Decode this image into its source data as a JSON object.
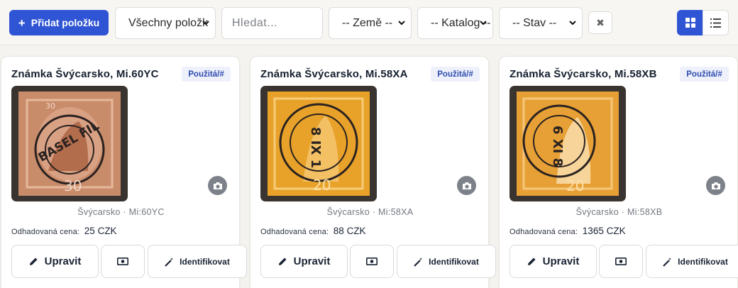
{
  "toolbar": {
    "add_label": "Přidat položku",
    "filter_all": "Všechny položk",
    "search_placeholder": "Hledat...",
    "country": "-- Země --",
    "catalog": "-- Katalog --",
    "state": "-- Stav --"
  },
  "price_label": "Odhadovaná cena:",
  "buttons": {
    "edit": "Upravit",
    "identify": "Identifikovat"
  },
  "cards": [
    {
      "title": "Známka Švýcarsko, Mi.60YC",
      "badge": "Použitá/#",
      "meta": "Švýcarsko · Mi:60YC",
      "price": "25 CZK"
    },
    {
      "title": "Známka Švýcarsko, Mi.58XA",
      "badge": "Použitá/#",
      "meta": "Švýcarsko · Mi:58XA",
      "price": "88 CZK"
    },
    {
      "title": "Známka Švýcarsko, Mi.58XB",
      "badge": "Použitá/#",
      "meta": "Švýcarsko · Mi:58XB",
      "price": "1365 CZK"
    }
  ],
  "colors": {
    "accent": "#2f55d4",
    "stamp_1": "#c98c6a",
    "stamp_2": "#e8a22a",
    "stamp_3": "#e7a035"
  }
}
